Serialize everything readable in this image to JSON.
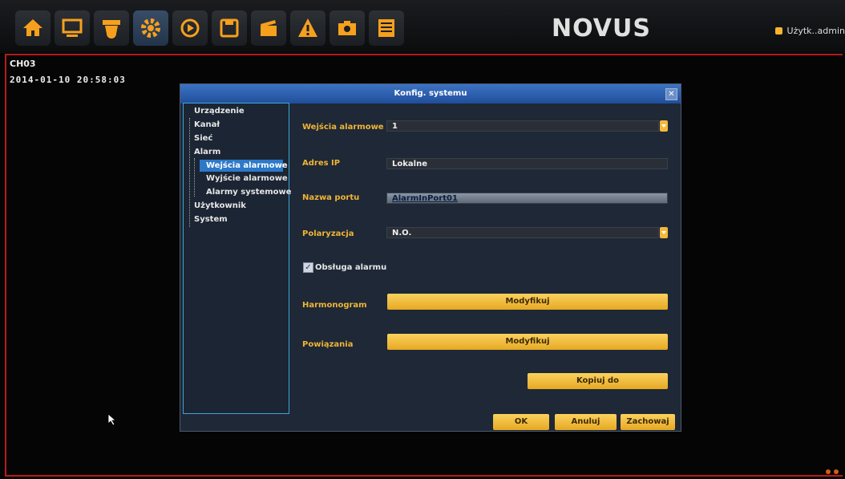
{
  "toolbar": {
    "items": [
      {
        "icon": "home-icon"
      },
      {
        "icon": "monitor-icon"
      },
      {
        "icon": "camera-icon"
      },
      {
        "icon": "gear-icon"
      },
      {
        "icon": "play-icon"
      },
      {
        "icon": "save-icon"
      },
      {
        "icon": "clapper-icon"
      },
      {
        "icon": "warning-icon"
      },
      {
        "icon": "photo-camera-icon"
      },
      {
        "icon": "list-icon"
      }
    ],
    "active_index": 3,
    "accent_color": "#f7a01d",
    "logo": "NOVUS",
    "user": "Użytk..admin"
  },
  "overlay": {
    "channel": "CH03",
    "datetime": "2014-01-10 20:58:03"
  },
  "dialog": {
    "title": "Konfig. systemu",
    "close": "✕",
    "tree": {
      "items": [
        {
          "label": "Urządzenie"
        },
        {
          "label": "Kanał"
        },
        {
          "label": "Sieć"
        },
        {
          "label": "Alarm"
        },
        {
          "label": "Wejścia alarmowe",
          "selected": true
        },
        {
          "label": "Wyjście alarmowe"
        },
        {
          "label": "Alarmy systemowe"
        },
        {
          "label": "Użytkownik"
        },
        {
          "label": "System"
        }
      ]
    },
    "form": {
      "alarm_input_label": "Wejścia alarmowe",
      "alarm_input_value": "1",
      "ip_label": "Adres IP",
      "ip_value": "Lokalne",
      "port_label": "Nazwa portu",
      "port_value": "AlarmInPort01",
      "polarity_label": "Polaryzacja",
      "polarity_value": "N.O.",
      "handling_label": "Obsługa alarmu",
      "handling_checked": true,
      "schedule_label": "Harmonogram",
      "schedule_button": "Modyfikuj",
      "links_label": "Powiązania",
      "links_button": "Modyfikuj",
      "copy_button": "Kopiuj do"
    },
    "footer": {
      "ok": "OK",
      "cancel": "Anuluj",
      "save": "Zachowaj"
    }
  }
}
